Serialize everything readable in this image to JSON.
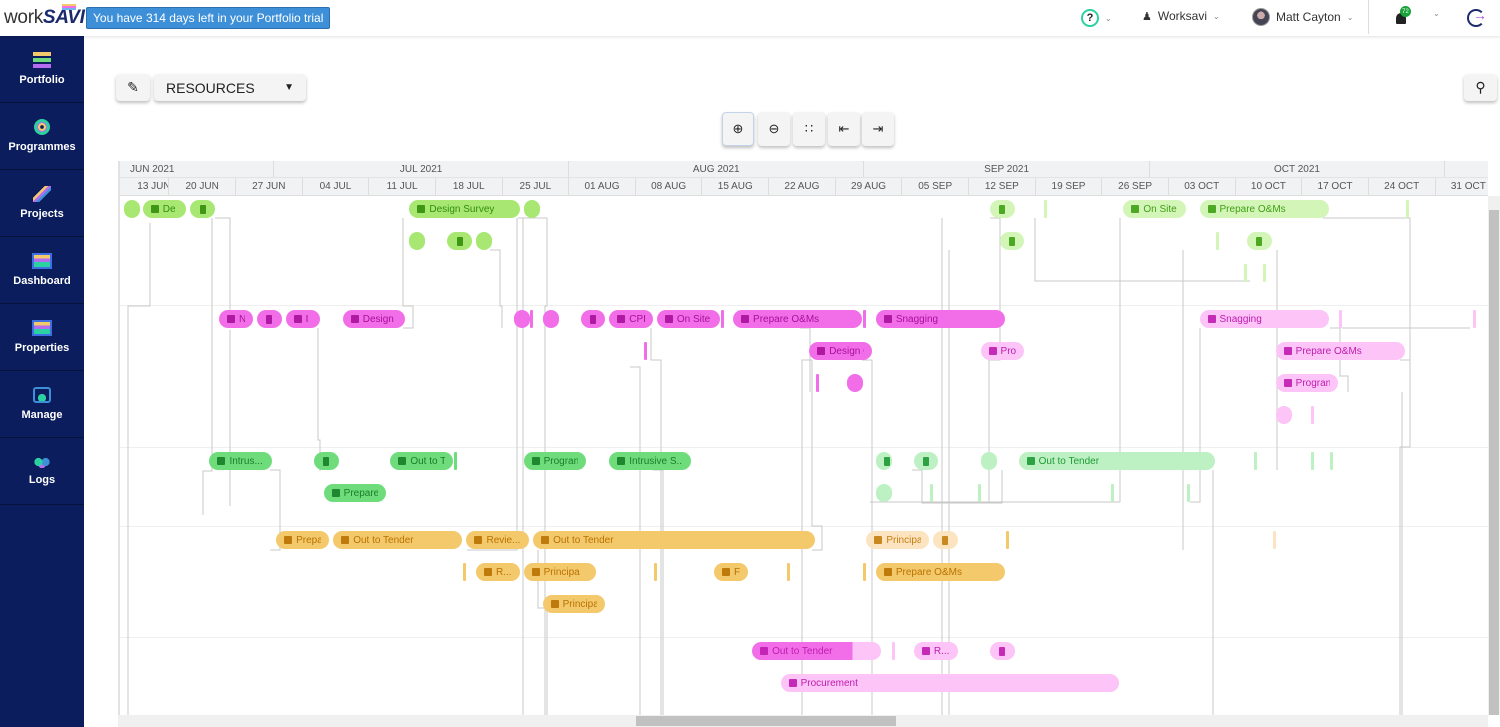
{
  "topbar": {
    "logo": "worksavi",
    "trial_banner": "You have 314 days left in your Portfolio trial",
    "workspace": "Worksavi",
    "user": "Matt Cayton",
    "notification_count": "72"
  },
  "sidebar": {
    "items": [
      {
        "label": "Portfolio"
      },
      {
        "label": "Programmes"
      },
      {
        "label": "Projects"
      },
      {
        "label": "Dashboard"
      },
      {
        "label": "Properties"
      },
      {
        "label": "Manage"
      },
      {
        "label": "Logs"
      }
    ]
  },
  "toolbar": {
    "view_select": "RESOURCES"
  },
  "timeline": {
    "months": [
      {
        "label": "JUN 2021",
        "start": "2021-06-13",
        "end": "2021-07-01"
      },
      {
        "label": "JUL 2021",
        "start": "2021-07-01",
        "end": "2021-08-01"
      },
      {
        "label": "AUG 2021",
        "start": "2021-08-01",
        "end": "2021-09-01"
      },
      {
        "label": "SEP 2021",
        "start": "2021-09-01",
        "end": "2021-10-01"
      },
      {
        "label": "OCT 2021",
        "start": "2021-10-01",
        "end": "2021-11-01"
      },
      {
        "label": "",
        "start": "2021-11-01",
        "end": "2021-11-15"
      }
    ],
    "weeks": [
      "13 JUN",
      "20 JUN",
      "27 JUN",
      "04 JUL",
      "11 JUL",
      "18 JUL",
      "25 JUL",
      "01 AUG",
      "08 AUG",
      "15 AUG",
      "22 AUG",
      "29 AUG",
      "05 SEP",
      "12 SEP",
      "19 SEP",
      "26 SEP",
      "03 OCT",
      "10 OCT",
      "17 OCT",
      "24 OCT",
      "31 OCT"
    ],
    "week_start": "2021-06-13"
  },
  "colors": {
    "lime": [
      "#a8e872",
      "#338d0c"
    ],
    "lime-light": [
      "#d3f5b8",
      "#3fa014"
    ],
    "pink": [
      "#f26ee9",
      "#a80f98"
    ],
    "pink-light": [
      "#fcc4f7",
      "#bf1bb0"
    ],
    "green": [
      "#6fdc7c",
      "#187e2a"
    ],
    "green-light": [
      "#bdf1c4",
      "#1f9a35"
    ],
    "orange": [
      "#f4c96c",
      "#b87200"
    ],
    "orange-light": [
      "#fde4c0",
      "#c57e10"
    ]
  },
  "tasks": [
    {
      "row": 0,
      "start": "2021-06-15",
      "end": "2021-06-17",
      "color": "lime",
      "label": ""
    },
    {
      "row": 0,
      "start": "2021-06-17",
      "end": "2021-06-22",
      "color": "lime",
      "label": "De",
      "icon": "calendar"
    },
    {
      "row": 0,
      "start": "2021-06-22",
      "end": "2021-06-25",
      "color": "lime",
      "label": "",
      "icon": "bin"
    },
    {
      "row": 0,
      "start": "2021-07-15",
      "end": "2021-07-27",
      "color": "lime",
      "label": "Design Survey",
      "icon": "calendar"
    },
    {
      "row": 0,
      "start": "2021-07-27",
      "end": "2021-07-29",
      "color": "lime",
      "label": ""
    },
    {
      "row": 0,
      "start": "2021-09-14",
      "end": "2021-09-17",
      "color": "lime-light",
      "label": "",
      "icon": "bin"
    },
    {
      "row": 0,
      "start": "2021-09-28",
      "end": "2021-10-05",
      "color": "lime-light",
      "label": "On Site",
      "icon": "calendar"
    },
    {
      "row": 0,
      "start": "2021-10-06",
      "end": "2021-10-20",
      "color": "lime-light",
      "label": "Prepare O&Ms",
      "icon": "calendar"
    },
    {
      "row": 1,
      "start": "2021-07-15",
      "end": "2021-07-17",
      "color": "lime",
      "label": ""
    },
    {
      "row": 1,
      "start": "2021-07-19",
      "end": "2021-07-22",
      "color": "lime",
      "label": "",
      "icon": "bin"
    },
    {
      "row": 1,
      "start": "2021-07-22",
      "end": "2021-07-24",
      "color": "lime",
      "label": ""
    },
    {
      "row": 1,
      "start": "2021-09-15",
      "end": "2021-09-18",
      "color": "lime-light",
      "label": "",
      "icon": "bin"
    },
    {
      "row": 1,
      "start": "2021-10-11",
      "end": "2021-10-14",
      "color": "lime-light",
      "label": "",
      "icon": "bin"
    },
    {
      "row": 3,
      "start": "2021-06-25",
      "end": "2021-06-29",
      "color": "pink",
      "label": "N",
      "icon": "calendar"
    },
    {
      "row": 3,
      "start": "2021-06-29",
      "end": "2021-07-02",
      "color": "pink",
      "label": "",
      "icon": "bin"
    },
    {
      "row": 3,
      "start": "2021-07-02",
      "end": "2021-07-06",
      "color": "pink",
      "label": "I",
      "icon": "calendar"
    },
    {
      "row": 3,
      "start": "2021-07-08",
      "end": "2021-07-15",
      "color": "pink",
      "label": "Design C",
      "icon": "calendar"
    },
    {
      "row": 3,
      "start": "2021-07-26",
      "end": "2021-07-28",
      "color": "pink",
      "label": ""
    },
    {
      "row": 3,
      "start": "2021-07-29",
      "end": "2021-07-31",
      "color": "pink",
      "label": ""
    },
    {
      "row": 3,
      "start": "2021-08-02",
      "end": "2021-08-05",
      "color": "pink",
      "label": "",
      "icon": "bin"
    },
    {
      "row": 3,
      "start": "2021-08-05",
      "end": "2021-08-10",
      "color": "pink",
      "label": "CPI",
      "icon": "calendar"
    },
    {
      "row": 3,
      "start": "2021-08-10",
      "end": "2021-08-17",
      "color": "pink",
      "label": "On Site",
      "icon": "calendar"
    },
    {
      "row": 3,
      "start": "2021-08-18",
      "end": "2021-09-01",
      "color": "pink",
      "label": "Prepare O&Ms",
      "icon": "calendar"
    },
    {
      "row": 3,
      "start": "2021-09-02",
      "end": "2021-09-16",
      "color": "pink",
      "label": "Snagging",
      "icon": "calendar"
    },
    {
      "row": 3,
      "start": "2021-10-06",
      "end": "2021-10-20",
      "color": "pink-light",
      "label": "Snagging",
      "icon": "calendar"
    },
    {
      "row": 4,
      "start": "2021-08-26",
      "end": "2021-09-02",
      "color": "pink",
      "label": "Design C",
      "icon": "calendar"
    },
    {
      "row": 4,
      "start": "2021-09-13",
      "end": "2021-09-18",
      "color": "pink-light",
      "label": "Pro",
      "icon": "calendar"
    },
    {
      "row": 4,
      "start": "2021-10-14",
      "end": "2021-10-28",
      "color": "pink-light",
      "label": "Prepare O&Ms",
      "icon": "calendar"
    },
    {
      "row": 5,
      "start": "2021-08-30",
      "end": "2021-09-01",
      "color": "pink",
      "label": ""
    },
    {
      "row": 5,
      "start": "2021-10-14",
      "end": "2021-10-21",
      "color": "pink-light",
      "label": "Progran",
      "icon": "calendar"
    },
    {
      "row": 6,
      "start": "2021-10-14",
      "end": "2021-10-16",
      "color": "pink-light",
      "label": ""
    },
    {
      "row": 7,
      "start": "2021-06-24",
      "end": "2021-07-01",
      "color": "green",
      "label": "Intrus...",
      "icon": "calendar"
    },
    {
      "row": 7,
      "start": "2021-07-05",
      "end": "2021-07-08",
      "color": "green",
      "label": "",
      "icon": "bin"
    },
    {
      "row": 7,
      "start": "2021-07-13",
      "end": "2021-07-20",
      "color": "green",
      "label": "Out to T",
      "icon": "calendar"
    },
    {
      "row": 7,
      "start": "2021-07-27",
      "end": "2021-08-03",
      "color": "green",
      "label": "Progran",
      "icon": "calendar"
    },
    {
      "row": 7,
      "start": "2021-08-05",
      "end": "2021-08-14",
      "color": "green",
      "label": "Intrusive S...",
      "icon": "calendar"
    },
    {
      "row": 7,
      "start": "2021-09-02",
      "end": "2021-09-04",
      "color": "green-light",
      "label": "",
      "icon": "bin"
    },
    {
      "row": 7,
      "start": "2021-09-06",
      "end": "2021-09-09",
      "color": "green-light",
      "label": "",
      "icon": "bin"
    },
    {
      "row": 7,
      "start": "2021-09-13",
      "end": "2021-09-15",
      "color": "green-light",
      "label": ""
    },
    {
      "row": 7,
      "start": "2021-09-17",
      "end": "2021-10-08",
      "color": "green-light",
      "label": "Out to Tender",
      "icon": "calendar"
    },
    {
      "row": 8,
      "start": "2021-07-06",
      "end": "2021-07-13",
      "color": "green",
      "label": "Prepare",
      "icon": "calendar"
    },
    {
      "row": 8,
      "start": "2021-09-02",
      "end": "2021-09-04",
      "color": "green-light",
      "label": ""
    },
    {
      "row": 9,
      "start": "2021-07-01",
      "end": "2021-07-07",
      "color": "orange",
      "label": "Prepa",
      "icon": "calendar"
    },
    {
      "row": 9,
      "start": "2021-07-07",
      "end": "2021-07-21",
      "color": "orange",
      "label": "Out to Tender",
      "icon": "calendar"
    },
    {
      "row": 9,
      "start": "2021-07-21",
      "end": "2021-07-28",
      "color": "orange",
      "label": "Revie...",
      "icon": "calendar"
    },
    {
      "row": 9,
      "start": "2021-07-28",
      "end": "2021-08-27",
      "color": "orange",
      "label": "Out to Tender",
      "icon": "calendar"
    },
    {
      "row": 9,
      "start": "2021-09-01",
      "end": "2021-09-08",
      "color": "orange-light",
      "label": "Principa",
      "icon": "calendar"
    },
    {
      "row": 9,
      "start": "2021-09-08",
      "end": "2021-09-11",
      "color": "orange-light",
      "label": "",
      "icon": "bin"
    },
    {
      "row": 10,
      "start": "2021-07-22",
      "end": "2021-07-27",
      "color": "orange",
      "label": "R...",
      "icon": "calendar"
    },
    {
      "row": 10,
      "start": "2021-07-27",
      "end": "2021-08-04",
      "color": "orange",
      "label": "Principa",
      "icon": "calendar"
    },
    {
      "row": 10,
      "start": "2021-08-16",
      "end": "2021-08-20",
      "color": "orange",
      "label": "F",
      "icon": "calendar"
    },
    {
      "row": 10,
      "start": "2021-09-02",
      "end": "2021-09-16",
      "color": "orange",
      "label": "Prepare O&Ms",
      "icon": "calendar"
    },
    {
      "row": 11,
      "start": "2021-07-29",
      "end": "2021-08-05",
      "color": "orange",
      "label": "Principa",
      "icon": "calendar"
    },
    {
      "row": 12,
      "start": "2021-08-20",
      "end": "2021-09-03",
      "color": "pink-light",
      "label": "Out to Tender",
      "icon": "calendar",
      "progress": 0.78,
      "progress_color": "pink"
    },
    {
      "row": 12,
      "start": "2021-09-06",
      "end": "2021-09-11",
      "color": "pink-light",
      "label": "R...",
      "icon": "calendar"
    },
    {
      "row": 12,
      "start": "2021-09-14",
      "end": "2021-09-17",
      "color": "pink-light",
      "label": "",
      "icon": "bin"
    },
    {
      "row": 13,
      "start": "2021-08-23",
      "end": "2021-09-28",
      "color": "pink-light",
      "label": "Procurement",
      "icon": "calendar"
    }
  ],
  "milestones": [
    {
      "row": 0,
      "date": "2021-09-20",
      "color": "lime-light"
    },
    {
      "row": 0,
      "date": "2021-10-28",
      "color": "lime-light"
    },
    {
      "row": 1,
      "date": "2021-10-08",
      "color": "lime-light"
    },
    {
      "row": 2,
      "date": "2021-10-11",
      "color": "lime-light"
    },
    {
      "row": 2,
      "date": "2021-10-13",
      "color": "lime-light"
    },
    {
      "row": 3,
      "date": "2021-07-28",
      "color": "pink"
    },
    {
      "row": 3,
      "date": "2021-08-17",
      "color": "pink"
    },
    {
      "row": 3,
      "date": "2021-09-01",
      "color": "pink"
    },
    {
      "row": 3,
      "date": "2021-10-21",
      "color": "pink-light"
    },
    {
      "row": 3,
      "date": "2021-11-04",
      "color": "pink-light"
    },
    {
      "row": 4,
      "date": "2021-08-09",
      "color": "pink"
    },
    {
      "row": 5,
      "date": "2021-08-27",
      "color": "pink"
    },
    {
      "row": 6,
      "date": "2021-10-18",
      "color": "pink-light"
    },
    {
      "row": 7,
      "date": "2021-07-20",
      "color": "green"
    },
    {
      "row": 7,
      "date": "2021-10-12",
      "color": "green-light"
    },
    {
      "row": 7,
      "date": "2021-10-18",
      "color": "green-light"
    },
    {
      "row": 7,
      "date": "2021-10-20",
      "color": "green-light"
    },
    {
      "row": 8,
      "date": "2021-09-08",
      "color": "green-light"
    },
    {
      "row": 8,
      "date": "2021-09-13",
      "color": "green-light"
    },
    {
      "row": 8,
      "date": "2021-09-27",
      "color": "green-light"
    },
    {
      "row": 8,
      "date": "2021-10-05",
      "color": "green-light"
    },
    {
      "row": 9,
      "date": "2021-09-16",
      "color": "orange"
    },
    {
      "row": 9,
      "date": "2021-10-14",
      "color": "orange-light"
    },
    {
      "row": 10,
      "date": "2021-07-21",
      "color": "orange"
    },
    {
      "row": 10,
      "date": "2021-08-10",
      "color": "orange"
    },
    {
      "row": 10,
      "date": "2021-08-24",
      "color": "orange"
    },
    {
      "row": 10,
      "date": "2021-09-01",
      "color": "orange"
    },
    {
      "row": 12,
      "date": "2021-09-04",
      "color": "pink-light"
    }
  ]
}
